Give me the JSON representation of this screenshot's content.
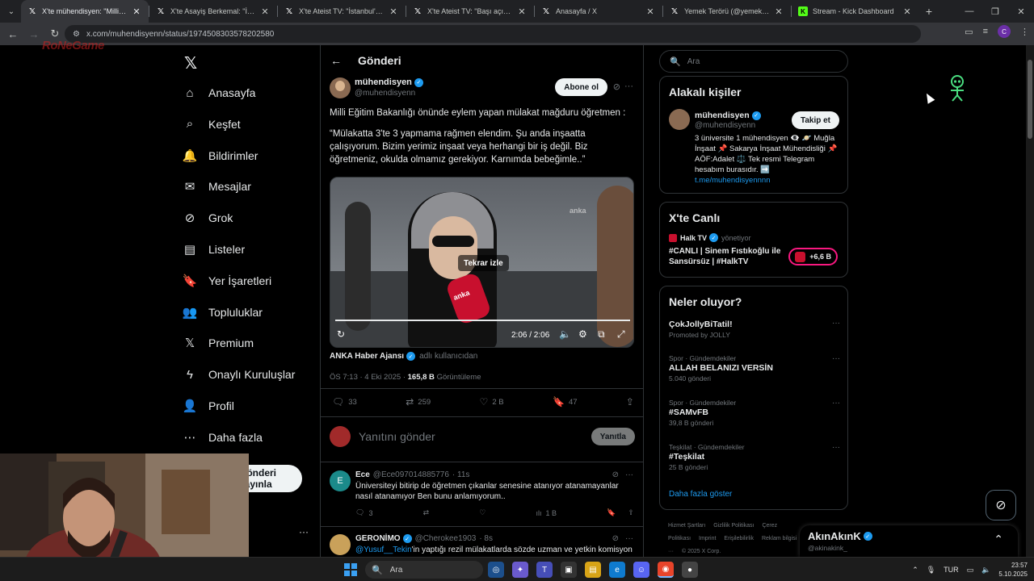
{
  "browser": {
    "tabs": [
      {
        "title": "X'te mühendisyen: \"Milli Eğitim",
        "active": true,
        "icon": "x-logo-icon"
      },
      {
        "title": "X'te Asayiş Berkemal: \"İstanbul",
        "active": false,
        "icon": "x-logo-icon"
      },
      {
        "title": "X'te Ateist TV: \"İstanbul'da pik",
        "active": false,
        "icon": "x-logo-icon"
      },
      {
        "title": "X'te Ateist TV: \"Başı açık bir ka",
        "active": false,
        "icon": "x-logo-icon"
      },
      {
        "title": "Anasayfa / X",
        "active": false,
        "icon": "x-logo-icon"
      },
      {
        "title": "Yemek Terörü (@yemekteroru_)",
        "active": false,
        "icon": "x-logo-icon"
      },
      {
        "title": "Stream - Kick Dashboard",
        "active": false,
        "icon": "kick-logo-icon"
      }
    ],
    "url": "x.com/muhendisyenn/status/1974508303578202580",
    "profile_initial": "C"
  },
  "overlay": {
    "stream_logo": "RoNeGame"
  },
  "nav": {
    "items": [
      {
        "label": "Anasayfa",
        "icon": "home-icon"
      },
      {
        "label": "Keşfet",
        "icon": "search-icon"
      },
      {
        "label": "Bildirimler",
        "icon": "bell-icon"
      },
      {
        "label": "Mesajlar",
        "icon": "mail-icon"
      },
      {
        "label": "Grok",
        "icon": "grok-icon"
      },
      {
        "label": "Listeler",
        "icon": "list-icon"
      },
      {
        "label": "Yer İşaretleri",
        "icon": "bookmark-icon"
      },
      {
        "label": "Topluluklar",
        "icon": "communities-icon"
      },
      {
        "label": "Premium",
        "icon": "x-premium-icon"
      },
      {
        "label": "Onaylı Kuruluşlar",
        "icon": "lightning-icon"
      },
      {
        "label": "Profil",
        "icon": "profile-icon"
      },
      {
        "label": "Daha fazla",
        "icon": "more-icon"
      }
    ],
    "post_button": "Gönderi yayınla"
  },
  "main": {
    "header_title": "Gönderi",
    "author": {
      "name": "mühendisyen",
      "handle": "@muhendisyenn",
      "subscribe": "Abone ol"
    },
    "post_lines": [
      "Milli Eğitim Bakanlığı önünde eylem yapan mülakat mağduru öğretmen :",
      "“Mülakatta 3'te 3 yapmama rağmen elendim. Şu anda inşaatta çalışıyorum. Bizim yerimiz inşaat veya herhangi bir iş değil. Biz öğretmeniz, okulda olmamız gerekiyor. Karnımda bebeğimle..”"
    ],
    "video": {
      "replay_label": "Tekrar izle",
      "time": "2:06 / 2:06",
      "watermark": "anka",
      "mic_label": "anka",
      "progress": 1.0
    },
    "source": {
      "name": "ANKA Haber Ajansı",
      "suffix": "adlı kullanıcıdan"
    },
    "meta": {
      "time": "ÖS 7:13 · 4 Eki 2025 · ",
      "views": "165,8 B",
      "views_label": "Görüntüleme"
    },
    "stats": {
      "replies": "33",
      "reposts": "259",
      "likes": "2 B",
      "bookmarks": "47"
    },
    "reply_box": {
      "placeholder": "Yanıtını gönder",
      "button": "Yanıtla"
    },
    "comments": [
      {
        "name": "Ece",
        "handle": "@Ece097014885776",
        "time": "· 11s",
        "avatar_initial": "E",
        "avatar_color": "#1b8a8a",
        "text": "Üniversiteyi bitirip de öğretmen çıkanlar senesine atanıyor atanamayanlar nasıl atanamıyor Ben bunu anlamıyorum..",
        "replies": "3",
        "views": "1 B"
      },
      {
        "name": "GERONİMO",
        "handle": "@Cherokee1903",
        "time": "· 8s",
        "avatar_color": "#c9a15a",
        "mention": "@Yusuf__Tekin",
        "text": "'in yaptığı rezil mülakatlarda sözde uzman ve yetkin komisyon"
      }
    ]
  },
  "right": {
    "search_placeholder": "Ara",
    "related": {
      "title": "Alakalı kişiler",
      "name": "mühendisyen",
      "handle": "@muhendisyenn",
      "follow": "Takip et",
      "bio": "3 üniversite 1 mühendisyen 👁‍🗨 🪐 Muğla İnşaat 📌 Sakarya İnşaat Mühendisliği 📌 AÖF:Adalet ⚖️ Tek resmi Telegram hesabım burasıdır. ➡️",
      "link": "t.me/muhendisyennnn"
    },
    "live": {
      "title": "X'te Canlı",
      "host": "Halk TV",
      "host_suffix": "yönetiyor",
      "stream_title": "#CANLI | Sinem Fıstıkoğlu ile Sansürsüz | #HalkTV",
      "viewers": "+6,6 B"
    },
    "trends": {
      "title": "Neler oluyor?",
      "items": [
        {
          "meta": "",
          "name": "ÇokJollyBiTatil!",
          "count": "Promoted by JOLLY"
        },
        {
          "meta": "Spor · Gündemdekiler",
          "name": "ALLAH BELANIZI VERSİN",
          "count": "5.040 gönderi"
        },
        {
          "meta": "Spor · Gündemdekiler",
          "name": "#SAMvFB",
          "count": "39,8 B gönderi"
        },
        {
          "meta": "Teşkilat · Gündemdekiler",
          "name": "#Teşkilat",
          "count": "25 B gönderi"
        }
      ],
      "show_more": "Daha fazla göster"
    },
    "footer": [
      "Hizmet Şartları",
      "Gizlilik Politikası",
      "Çerez Politikası",
      "Imprint",
      "Erişilebilirlik",
      "Reklam bilgisi",
      "Daha fazla ···",
      "© 2025 X Corp."
    ],
    "messages": {
      "name": "AkınAkınK",
      "handle": "@akinakink_"
    }
  },
  "taskbar": {
    "search_placeholder": "Ara",
    "lang": "TUR",
    "time": "23:57",
    "date": "5.10.2025"
  }
}
